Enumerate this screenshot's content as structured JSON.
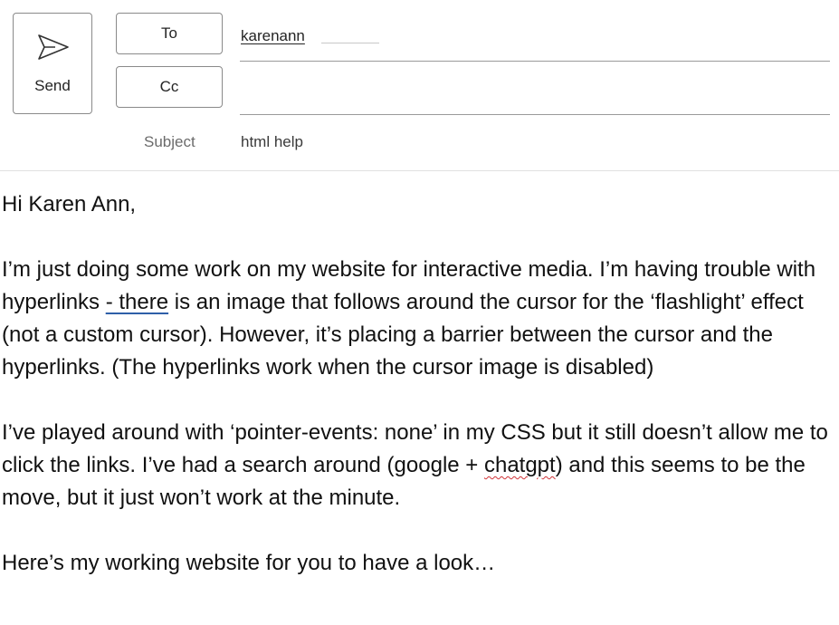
{
  "compose": {
    "send_label": "Send",
    "to_label": "To",
    "cc_label": "Cc",
    "to_recipients": [
      "karenann"
    ],
    "cc_recipients": [],
    "subject_label": "Subject",
    "subject_value": "html help"
  },
  "body": {
    "greeting": "Hi Karen Ann,",
    "p1_a": "I’m just doing some work on my website for interactive media. I’m having trouble with hyperlinks ",
    "p1_link": "- there",
    "p1_b": " is an image that follows around the cursor for the ‘flashlight’ effect  (not a custom cursor). However, it’s placing a barrier between the cursor and the hyperlinks. (The hyperlinks work when the cursor image is disabled)",
    "p2_a": "I’ve played around with ‘pointer-events: none’ in my CSS but it still doesn’t allow me to click the links. I’ve had a search around (google + ",
    "p2_spell": "chatgpt",
    "p2_b": ") and this seems to be the move, but it just won’t work at the minute.",
    "p3": "Here’s my working website for you to have a look…"
  },
  "colors": {
    "border": "#8a8a8a",
    "spellcheck": "#d13438",
    "link_underline": "#2e5fa8"
  },
  "icons": {
    "send": "send-icon"
  }
}
